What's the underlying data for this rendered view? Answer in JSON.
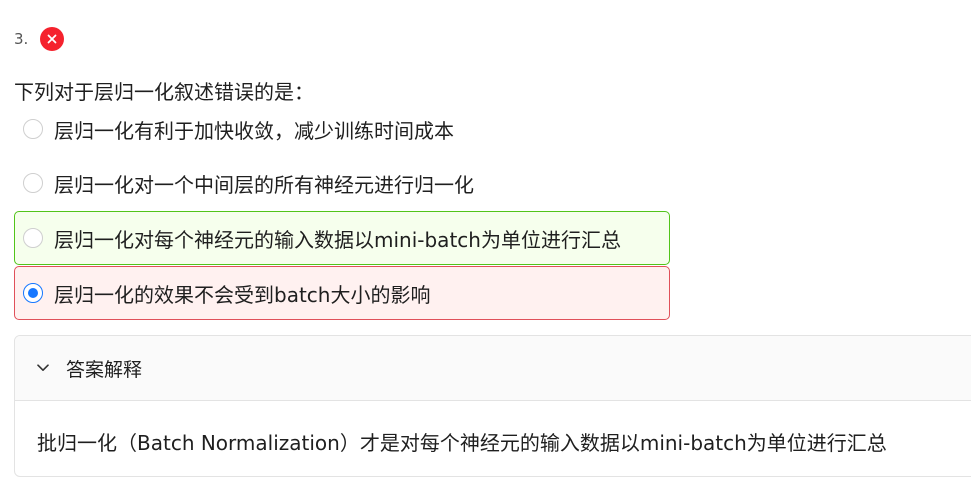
{
  "question": {
    "number": "3.",
    "status_icon": "close-icon",
    "stem": "下列对于层归一化叙述错误的是："
  },
  "options": [
    {
      "label": "层归一化有利于加快收敛，减少训练时间成本",
      "state": "normal",
      "selected": false
    },
    {
      "label": "层归一化对一个中间层的所有神经元进行归一化",
      "state": "normal",
      "selected": false
    },
    {
      "label": "层归一化对每个神经元的输入数据以mini-batch为单位进行汇总",
      "state": "correct",
      "selected": false
    },
    {
      "label": "层归一化的效果不会受到batch大小的影响",
      "state": "wrong",
      "selected": true
    }
  ],
  "explanation": {
    "header": "答案解释",
    "icon": "chevron-down-icon",
    "body": "批归一化（Batch Normalization）才是对每个神经元的输入数据以mini-batch为单位进行汇总"
  },
  "colors": {
    "wrong_badge": "#f5222d",
    "correct_bg": "#f6ffed",
    "correct_border": "#52c41a",
    "wrong_bg": "#fff1f0",
    "wrong_border": "#e0505a",
    "radio_checked": "#1677ff"
  }
}
